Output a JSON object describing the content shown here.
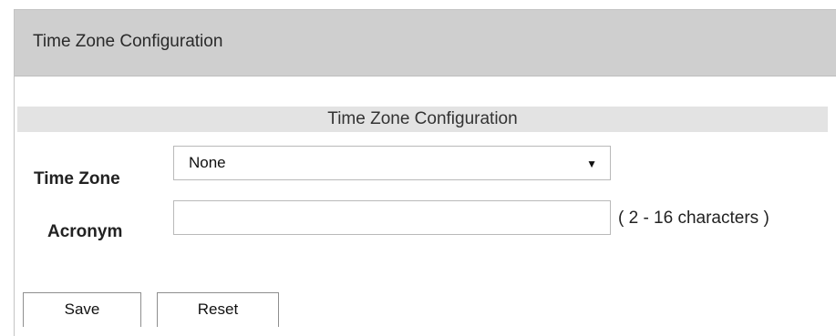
{
  "window": {
    "title": "Time Zone Configuration"
  },
  "section": {
    "header": "Time Zone Configuration"
  },
  "fields": {
    "time_zone": {
      "label": "Time Zone",
      "selected": "None",
      "arrow_icon": "triangle-down"
    },
    "acronym": {
      "label": "Acronym",
      "value": "",
      "hint": "( 2 - 16 characters )"
    }
  },
  "buttons": {
    "save": "Save",
    "reset": "Reset"
  }
}
